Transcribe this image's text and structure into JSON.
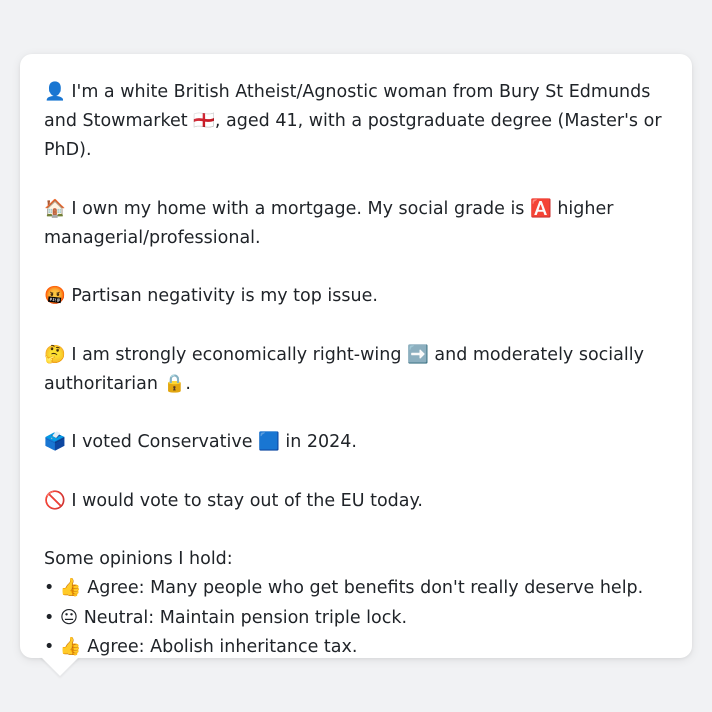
{
  "profile": {
    "identity": "👤 I'm a white British Atheist/Agnostic woman from Bury St Edmunds and Stowmarket 🏴󠁧󠁢󠁥󠁮󠁧󠁿, aged 41, with a postgraduate degree (Master's or PhD).",
    "housing": "🏠 I own my home with a mortgage. My social grade is 🅰️ higher managerial/professional.",
    "top_issue": "🤬 Partisan negativity is my top issue.",
    "ideology": "🤔 I am strongly economically right-wing ➡️ and moderately socially authoritarian 🔒.",
    "vote_2024": "🗳️ I voted Conservative 🟦 in 2024.",
    "eu": "🚫 I would vote to stay out of the EU today.",
    "opinions_heading": "Some opinions I hold:",
    "opinions": [
      "• 👍 Agree: Many people who get benefits don't really deserve help.",
      "• 😐 Neutral: Maintain pension triple lock.",
      "• 👍 Agree: Abolish inheritance tax."
    ]
  }
}
